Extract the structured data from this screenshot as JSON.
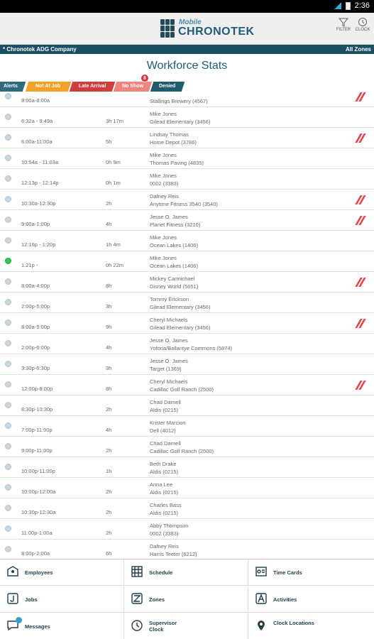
{
  "status_bar": {
    "time": "2:36"
  },
  "header": {
    "logo_small": "Mobile",
    "logo_main": "CHRONOTEK",
    "filter_label": "FILTER",
    "clock_label": "CLOCK"
  },
  "company_bar": {
    "company": "* Chronotek ADG Company",
    "zone": "All Zones"
  },
  "page_title": "Workforce Stats",
  "filters": [
    {
      "label": "Alerts",
      "color": "#2e6b80"
    },
    {
      "label": "Not At Job",
      "color": "#f4a12a"
    },
    {
      "label": "Late Arrival",
      "color": "#cf3d3d"
    },
    {
      "label": "No Show",
      "color": "#f0857f"
    },
    {
      "label": "Denied",
      "color": "#1f5c6e"
    }
  ],
  "no_show_badge": "8",
  "rows": [
    {
      "time": "8:00a-8:00a",
      "duration": "",
      "name": "",
      "location": "Stallings Brewery (4567)",
      "flag": true,
      "active": false
    },
    {
      "time": "6:32a - 9:49a",
      "duration": "3h 17m",
      "name": "Mike Jones",
      "location": "Gilead Elementary (3456)",
      "flag": false,
      "active": false
    },
    {
      "time": "6:00a-11:00a",
      "duration": "5h",
      "name": "Lindsay Thomas",
      "location": "Home Depot (3786)",
      "flag": true,
      "active": false
    },
    {
      "time": "10:54a - 11:03a",
      "duration": "0h 9m",
      "name": "Mike Jones",
      "location": "Thomas Paving (4835)",
      "flag": false,
      "active": false
    },
    {
      "time": "12:13p - 12:14p",
      "duration": "0h 1m",
      "name": "Mike Jones",
      "location": "0002 (3383)",
      "flag": false,
      "active": false
    },
    {
      "time": "10:30a-12:30p",
      "duration": "2h",
      "name": "Dafney Reis",
      "location": "Anytime Fitness 3540 (3540)",
      "flag": true,
      "active": false
    },
    {
      "time": "9:00a-1:00p",
      "duration": "4h",
      "name": "Jesse O. James",
      "location": "Planet Fitness (3210)",
      "flag": true,
      "active": false
    },
    {
      "time": "12:16p - 1:20p",
      "duration": "1h 4m",
      "name": "Mike Jones",
      "location": "Ocean Lakes (1406)",
      "flag": false,
      "active": false
    },
    {
      "time": "1:21p -",
      "duration": "0h 22m",
      "name": "Mike Jones",
      "location": "Ocean Lakes (1406)",
      "flag": false,
      "active": true
    },
    {
      "time": "8:00a-4:00p",
      "duration": "8h",
      "name": "Mickey Carmichael",
      "location": "Disney World (5651)",
      "flag": true,
      "active": false
    },
    {
      "time": "2:00p-5:00p",
      "duration": "3h",
      "name": "Tommy Erickson",
      "location": "Gilead Elementary (3456)",
      "flag": false,
      "active": false
    },
    {
      "time": "8:00a-5:00p",
      "duration": "9h",
      "name": "Cheryl Michaels",
      "location": "Gilead Elementary (3456)",
      "flag": true,
      "active": false
    },
    {
      "time": "2:00p-6:00p",
      "duration": "4h",
      "name": "Jesse O. James",
      "location": "Yoforia/Ballantye Commons (5874)",
      "flag": false,
      "active": false
    },
    {
      "time": "3:30p-6:30p",
      "duration": "3h",
      "name": "Jesse O. James",
      "location": "Target (1369)",
      "flag": false,
      "active": false
    },
    {
      "time": "12:00p-8:00p",
      "duration": "8h",
      "name": "Cheryl Michaels",
      "location": "Cadillac Golf Ranch (2500)",
      "flag": true,
      "active": false
    },
    {
      "time": "8:30p-10:30p",
      "duration": "2h",
      "name": "Chad Darnell",
      "location": "Aldis (0215)",
      "flag": false,
      "active": false
    },
    {
      "time": "7:00p-11:00p",
      "duration": "4h",
      "name": "Krister Marcion",
      "location": "Dell (4012)",
      "flag": false,
      "active": false
    },
    {
      "time": "9:00p-11:00p",
      "duration": "2h",
      "name": "Chad Darnell",
      "location": "Cadillac Golf Ranch (2500)",
      "flag": false,
      "active": false
    },
    {
      "time": "10:00p-11:00p",
      "duration": "1h",
      "name": "Beth Drake",
      "location": "Aldis (0215)",
      "flag": false,
      "active": false
    },
    {
      "time": "10:00p-12:00a",
      "duration": "2h",
      "name": "Anna Lee",
      "location": "Aldis (0215)",
      "flag": false,
      "active": false
    },
    {
      "time": "10:30p-12:30a",
      "duration": "2h",
      "name": "Charles Bass",
      "location": "Aldis (0215)",
      "flag": false,
      "active": false
    },
    {
      "time": "11:00p-1:00a",
      "duration": "2h",
      "name": "Abby Thompson",
      "location": "0002 (3383)",
      "flag": false,
      "active": false
    },
    {
      "time": "8:00p-2:00a",
      "duration": "6h",
      "name": "Dafney Reis",
      "location": "Harris Teeter (6212)",
      "flag": false,
      "active": false
    }
  ],
  "nav": [
    {
      "label": "Employees",
      "icon": "employees-icon"
    },
    {
      "label": "Schedule",
      "icon": "schedule-icon"
    },
    {
      "label": "Time Cards",
      "icon": "time-cards-icon"
    },
    {
      "label": "Jobs",
      "icon": "jobs-icon"
    },
    {
      "label": "Zones",
      "icon": "zones-icon"
    },
    {
      "label": "Activities",
      "icon": "activities-icon"
    },
    {
      "label": "Messages",
      "icon": "messages-icon"
    },
    {
      "label": "Supervisor Clock",
      "icon": "supervisor-clock-icon"
    },
    {
      "label": "Clock Locations",
      "icon": "clock-locations-icon"
    }
  ]
}
